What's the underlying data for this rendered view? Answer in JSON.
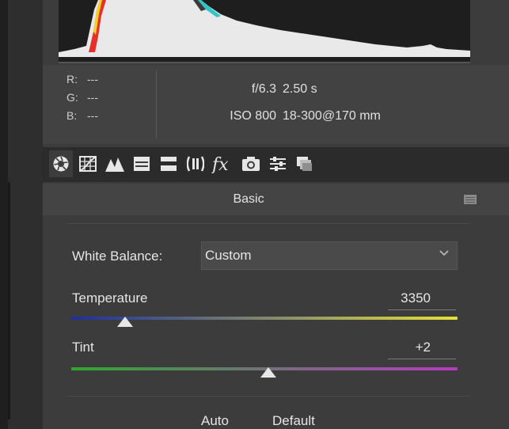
{
  "rgb": {
    "r_label": "R:",
    "r_value": "---",
    "g_label": "G:",
    "g_value": "---",
    "b_label": "B:",
    "b_value": "---"
  },
  "exif": {
    "aperture": "f/6.3",
    "shutter": "2.50 s",
    "iso": "ISO 800",
    "lens": "18-300@170 mm"
  },
  "tabs": [
    {
      "icon": "basic-aperture-icon"
    },
    {
      "icon": "tone-curve-icon"
    },
    {
      "icon": "detail-mountains-icon"
    },
    {
      "icon": "hsl-grayscale-icon"
    },
    {
      "icon": "split-toning-icon"
    },
    {
      "icon": "lens-corrections-icon"
    },
    {
      "icon": "fx-effects-icon"
    },
    {
      "icon": "camera-calibration-icon"
    },
    {
      "icon": "presets-sliders-icon"
    },
    {
      "icon": "snapshots-icon"
    }
  ],
  "section": {
    "title": "Basic"
  },
  "white_balance": {
    "label": "White Balance:",
    "value": "Custom"
  },
  "temperature": {
    "label": "Temperature",
    "value": "3350",
    "position": 0.14
  },
  "tint": {
    "label": "Tint",
    "value": "+2",
    "position": 0.51
  },
  "buttons": {
    "auto": "Auto",
    "default": "Default"
  },
  "colors": {
    "panel_bg": "#3c3c3c",
    "temp_track_start": "#1b2f9e",
    "temp_track_end": "#e6e03a",
    "tint_track_start": "#2ea82e",
    "tint_track_end": "#b83ac2"
  }
}
